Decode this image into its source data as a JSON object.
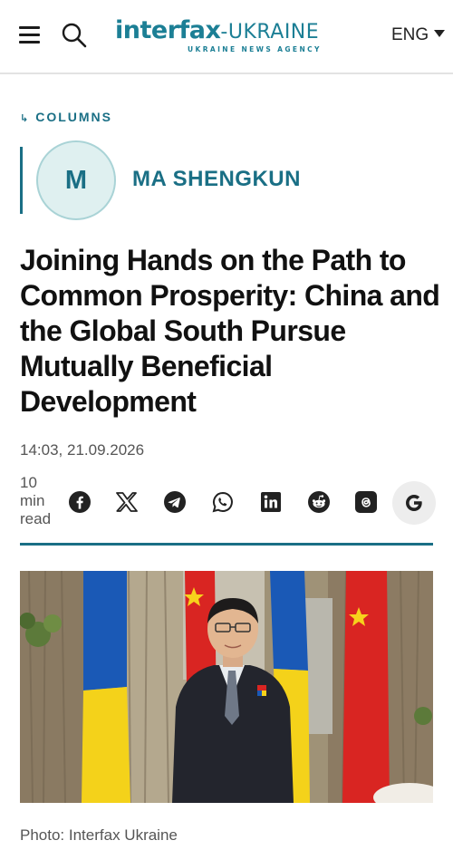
{
  "header": {
    "logo_brand": "interfax",
    "logo_suffix": "-UKRAINE",
    "logo_tagline": "UKRAINE NEWS AGENCY",
    "language": "ENG",
    "brand_color": "#1c7f95"
  },
  "section": {
    "label": "COLUMNS"
  },
  "author": {
    "initial": "M",
    "name": "MA SHENGKUN"
  },
  "article": {
    "title": "Joining Hands on the Path to Common Prosperity: China and the Global South Pursue Mutually Beneficial Development",
    "datetime": "14:03, 21.09.2026",
    "read_time": "10 min read",
    "accent_color": "#1a6f85"
  },
  "share_icons": [
    "facebook-icon",
    "x-icon",
    "telegram-icon",
    "whatsapp-icon",
    "linkedin-icon",
    "reddit-icon",
    "threads-icon",
    "google-icon"
  ],
  "photo": {
    "caption": "Photo: Interfax Ukraine"
  }
}
